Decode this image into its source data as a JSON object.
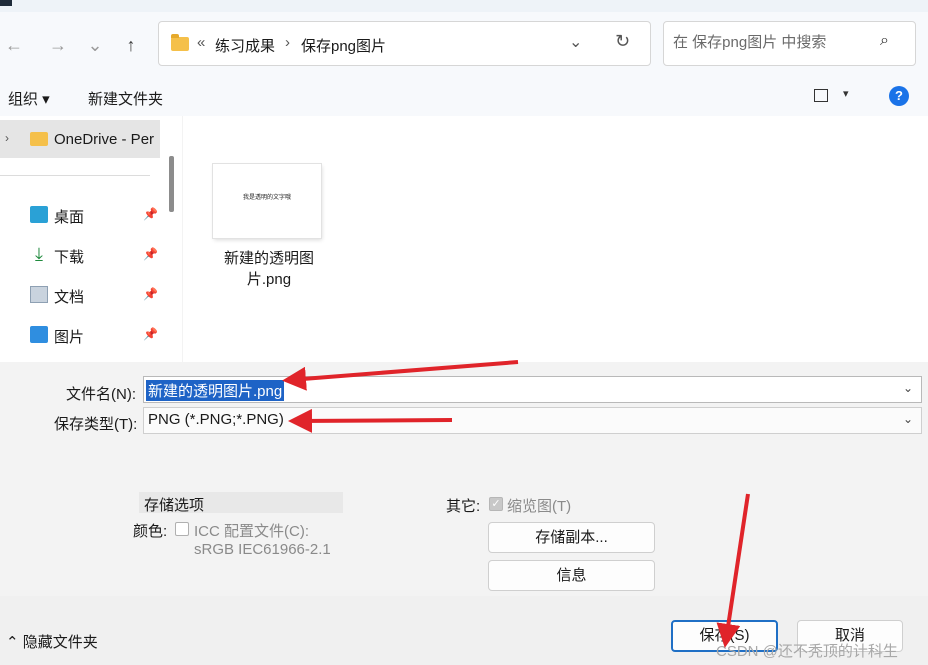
{
  "nav": {
    "back": "←",
    "forward": "→",
    "recent": "⌄",
    "up": "↑"
  },
  "address": {
    "overflow": "«",
    "crumbs": [
      "练习成果",
      "保存png图片"
    ],
    "separator": "›",
    "dropdown": "⌄",
    "refresh": "↻"
  },
  "search": {
    "placeholder": "在 保存png图片 中搜索",
    "icon": "⌕"
  },
  "toolbar": {
    "organize": "组织 ▾",
    "new_folder": "新建文件夹",
    "view_dropdown": "▾",
    "help": "?"
  },
  "sidebar": {
    "expand": "›",
    "onedrive": "OneDrive - Per",
    "pin": "📌",
    "items": [
      {
        "label": "桌面",
        "icon": "desktop-icon"
      },
      {
        "label": "下载",
        "icon": "download-icon",
        "glyph": "⤓"
      },
      {
        "label": "文档",
        "icon": "document-icon"
      },
      {
        "label": "图片",
        "icon": "pictures-icon"
      }
    ]
  },
  "files": [
    {
      "name": "新建的透明图片.png",
      "thumb_text": "我是透明的文字哦"
    }
  ],
  "form": {
    "filename_label": "文件名(N):",
    "filename_value": "新建的透明图片.png",
    "filetype_label": "保存类型(T):",
    "filetype_value": "PNG (*.PNG;*.PNG)",
    "dropdown": "⌄"
  },
  "options": {
    "header": "存储选项",
    "color_label": "颜色:",
    "icc_label": "ICC 配置文件(C):",
    "icc_value": "sRGB IEC61966-2.1",
    "other_label": "其它:",
    "thumbnail_label": "缩览图(T)",
    "thumbnail_checked": true,
    "check": "✓",
    "save_copy_button": "存储副本...",
    "info_button": "信息"
  },
  "footer": {
    "hide_folders": "⌃ 隐藏文件夹",
    "save_button": "保存(S)",
    "cancel_button": "取消",
    "watermark": "CSDN @还不秃顶的计科生"
  },
  "colors": {
    "accent": "#1f6fc5",
    "selection": "#1e63c6",
    "annotation": "#e0242a"
  }
}
